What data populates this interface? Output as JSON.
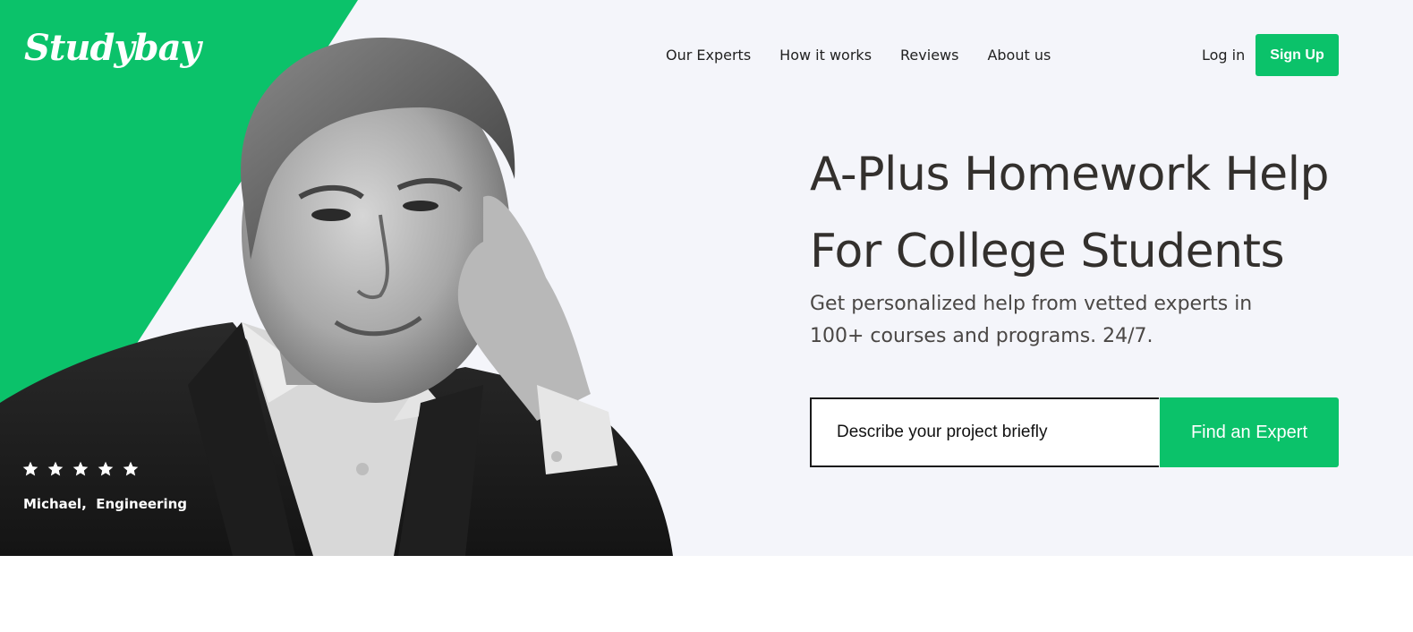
{
  "brand": {
    "logo_text": "Studybay",
    "accent_color": "#0bc26a"
  },
  "nav": {
    "items": [
      {
        "label": "Our Experts"
      },
      {
        "label": "How it works"
      },
      {
        "label": "Reviews"
      },
      {
        "label": "About us"
      }
    ]
  },
  "auth": {
    "login_label": "Log in",
    "signup_label": "Sign Up"
  },
  "hero": {
    "headline": "A-Plus Homework Help For College Students",
    "subtitle": "Get personalized help from vetted experts in 100+ courses and programs. 24/7.",
    "search_placeholder": "Describe your project briefly",
    "search_value": "",
    "cta_label": "Find an Expert"
  },
  "testimonial": {
    "rating": 5,
    "stars_icon": "star-icon",
    "reviewer": "Michael,  Engineering"
  }
}
